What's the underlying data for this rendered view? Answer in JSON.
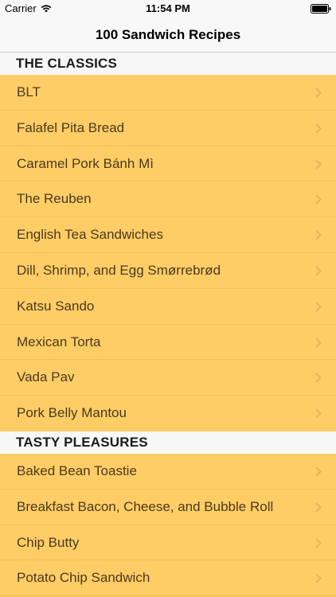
{
  "status_bar": {
    "carrier": "Carrier",
    "time": "11:54 PM"
  },
  "nav": {
    "title": "100 Sandwich Recipes"
  },
  "sections": [
    {
      "header": "THE CLASSICS",
      "items": [
        "BLT",
        "Falafel Pita Bread",
        "Caramel Pork Bánh Mì",
        "The Reuben",
        "English Tea Sandwiches",
        "Dill, Shrimp, and Egg Smørrebrød",
        "Katsu Sando",
        "Mexican Torta",
        "Vada Pav",
        "Pork Belly Mantou"
      ]
    },
    {
      "header": "TASTY PLEASURES",
      "items": [
        "Baked Bean Toastie",
        "Breakfast Bacon, Cheese, and Bubble Roll",
        "Chip Butty",
        "Potato Chip Sandwich"
      ]
    }
  ],
  "colors": {
    "row_background": "#ffcd66",
    "header_background": "#f7f7f7",
    "text": "#4a3a1e",
    "chevron": "#e6b45a"
  },
  "icons": {
    "wifi": "wifi-icon",
    "battery": "battery-icon",
    "chevron": "chevron-right-icon"
  }
}
